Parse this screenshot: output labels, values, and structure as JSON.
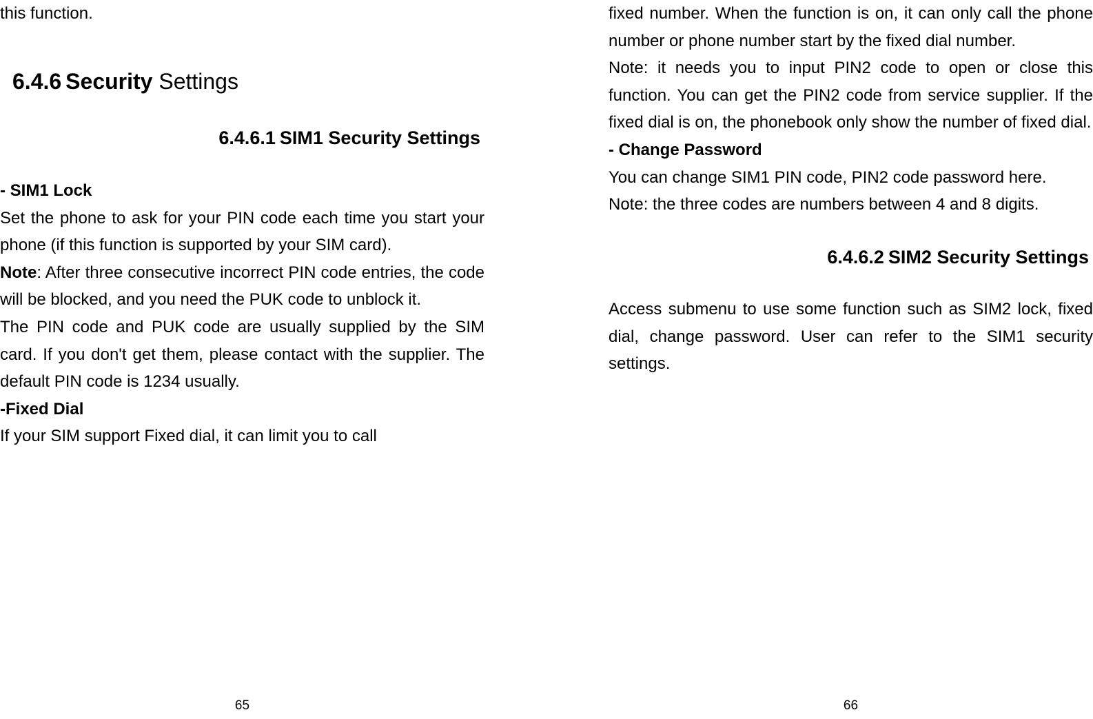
{
  "left": {
    "intro": "this function.",
    "h2_num": "6.4.6",
    "h2_bold": "Security",
    "h2_reg": " Settings",
    "h3_num": "6.4.6.1",
    "h3_title": "SIM1 Security Settings",
    "sub1": "- SIM1 Lock",
    "p1": "Set the phone to ask for your PIN code each time you start your phone (if this function is supported by your SIM card).",
    "note_label": "Note",
    "p2": ": After three consecutive incorrect PIN code entries, the code will be blocked, and you need the PUK code to unblock it.",
    "p3": "The PIN code and PUK code are usually supplied by the SIM card. If you don't get them, please contact with the supplier. The default PIN code is 1234 usually.",
    "sub2": "-Fixed Dial",
    "p4": "If your SIM support Fixed dial, it can limit you to call",
    "pagenum": "65"
  },
  "right": {
    "p1": "fixed number. When the function is on, it can only call the phone number or phone number start by the fixed dial number.",
    "p2": "Note: it needs you to input PIN2 code to open or close this function. You can get the PIN2 code from service supplier. If the fixed dial is on, the phonebook only show the number of fixed dial.",
    "sub1": "- Change Password",
    "p3": "You can change SIM1 PIN code, PIN2 code password here.",
    "p4": "Note: the three codes are numbers between 4 and 8 digits.",
    "h3_num": "6.4.6.2",
    "h3_title": "SIM2 Security Settings",
    "p5": "Access submenu to use some function such as SIM2 lock, fixed dial, change password. User can refer to the SIM1 security settings.",
    "pagenum": "66"
  }
}
